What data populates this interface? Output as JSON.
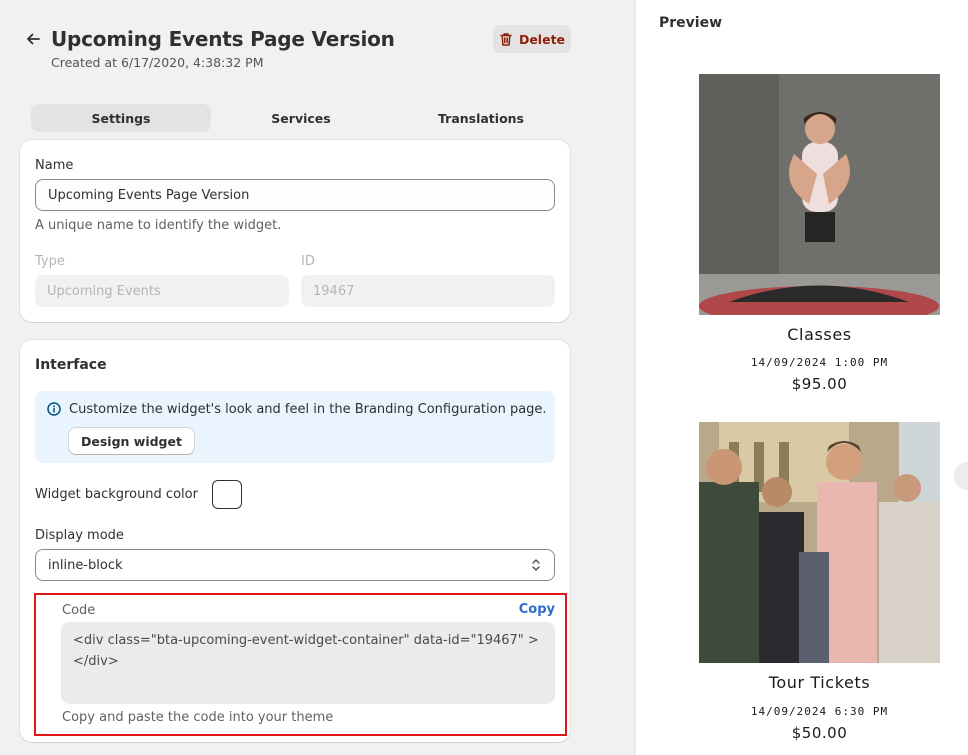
{
  "header": {
    "title": "Upcoming Events Page Version",
    "created": "Created at 6/17/2020, 4:38:32 PM",
    "delete_label": "Delete"
  },
  "tabs": [
    {
      "label": "Settings",
      "active": true
    },
    {
      "label": "Services",
      "active": false
    },
    {
      "label": "Translations",
      "active": false
    }
  ],
  "general": {
    "name_label": "Name",
    "name_value": "Upcoming Events Page Version",
    "name_help": "A unique name to identify the widget.",
    "type_label": "Type",
    "type_value": "Upcoming Events",
    "id_label": "ID",
    "id_value": "19467"
  },
  "interface": {
    "title": "Interface",
    "banner_text": "Customize the widget's look and feel in the Branding Configuration page.",
    "design_button": "Design widget",
    "bg_color_label": "Widget background color",
    "bg_color_value": "#ffffff",
    "display_mode_label": "Display mode",
    "display_mode_value": "inline-block",
    "code_label": "Code",
    "copy_label": "Copy",
    "code_line1": "<div class=\"bta-upcoming-event-widget-container\" data-id=\"19467\" >",
    "code_line2": "</div>",
    "code_help": "Copy and paste the code into your theme"
  },
  "preview": {
    "title": "Preview",
    "events": [
      {
        "name": "Classes",
        "date": "14/09/2024 1:00 PM",
        "price": "$95.00"
      },
      {
        "name": "Tour Tickets",
        "date": "14/09/2024 6:30 PM",
        "price": "$50.00"
      }
    ]
  },
  "colors": {
    "accent_link": "#2c6ecb",
    "delete_text": "#8e1f0b",
    "highlight_border": "#e0161b",
    "banner_bg": "#eaf4ff"
  }
}
